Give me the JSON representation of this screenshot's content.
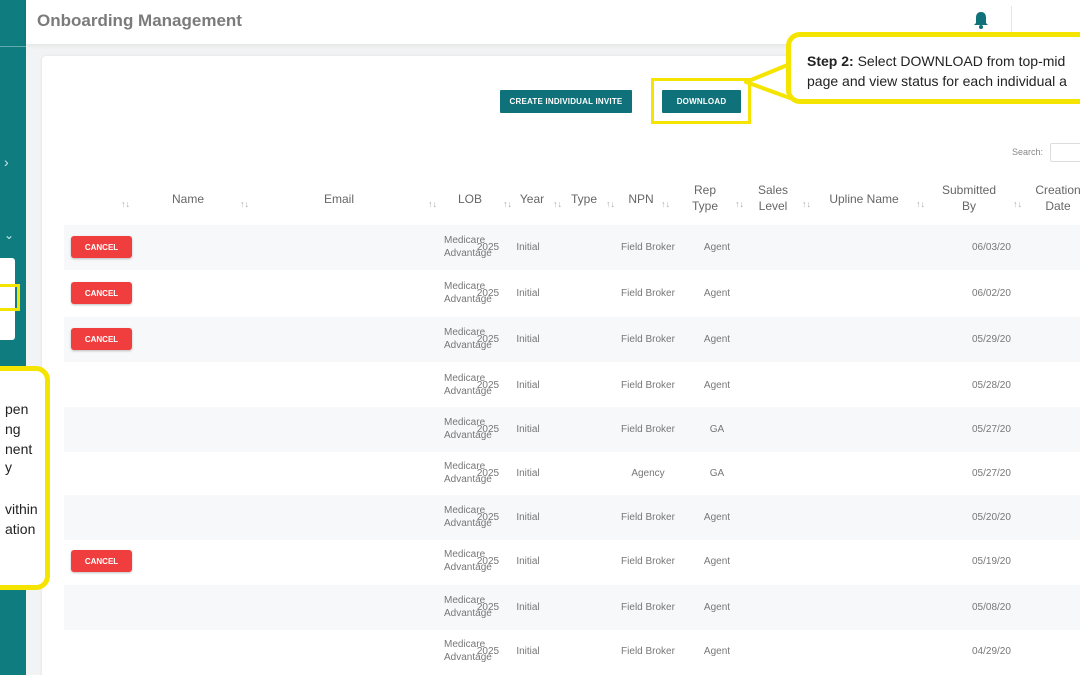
{
  "app": {
    "title": "Onboarding Management"
  },
  "toolbar": {
    "create_label": "CREATE INDIVIDUAL INVITE",
    "download_label": "DOWNLOAD"
  },
  "search": {
    "label": "Search:"
  },
  "table": {
    "columns": [
      "Name",
      "Email",
      "LOB",
      "Year",
      "Type",
      "NPN",
      "Rep Type",
      "Sales Level",
      "Upline Name",
      "Submitted By",
      "Creation Date"
    ],
    "sort_arrow": "↑↓",
    "cancel_label": "CANCEL",
    "rows": [
      {
        "cancel": true,
        "lob": "Medicare Advantage",
        "year": "2025",
        "type": "Initial",
        "rep_type": "Field Broker",
        "sales_level": "Agent",
        "creation_date": "06/03/20"
      },
      {
        "cancel": true,
        "lob": "Medicare Advantage",
        "year": "2025",
        "type": "Initial",
        "rep_type": "Field Broker",
        "sales_level": "Agent",
        "creation_date": "06/02/20"
      },
      {
        "cancel": true,
        "lob": "Medicare Advantage",
        "year": "2025",
        "type": "Initial",
        "rep_type": "Field Broker",
        "sales_level": "Agent",
        "creation_date": "05/29/20"
      },
      {
        "cancel": false,
        "lob": "Medicare Advantage",
        "year": "2025",
        "type": "Initial",
        "rep_type": "Field Broker",
        "sales_level": "Agent",
        "creation_date": "05/28/20"
      },
      {
        "cancel": false,
        "lob": "Medicare Advantage",
        "year": "2025",
        "type": "Initial",
        "rep_type": "Field Broker",
        "sales_level": "GA",
        "creation_date": "05/27/20"
      },
      {
        "cancel": false,
        "lob": "Medicare Advantage",
        "year": "2025",
        "type": "Initial",
        "rep_type": "Agency",
        "sales_level": "GA",
        "creation_date": "05/27/20"
      },
      {
        "cancel": false,
        "lob": "Medicare Advantage",
        "year": "2025",
        "type": "Initial",
        "rep_type": "Field Broker",
        "sales_level": "Agent",
        "creation_date": "05/20/20"
      },
      {
        "cancel": true,
        "lob": "Medicare Advantage",
        "year": "2025",
        "type": "Initial",
        "rep_type": "Field Broker",
        "sales_level": "Agent",
        "creation_date": "05/19/20"
      },
      {
        "cancel": false,
        "lob": "Medicare Advantage",
        "year": "2025",
        "type": "Initial",
        "rep_type": "Field Broker",
        "sales_level": "Agent",
        "creation_date": "05/08/20"
      },
      {
        "cancel": false,
        "lob": "Medicare Advantage",
        "year": "2025",
        "type": "Initial",
        "rep_type": "Field Broker",
        "sales_level": "Agent",
        "creation_date": "04/29/20"
      }
    ]
  },
  "callouts": {
    "step2": {
      "bold": "Step 2:",
      "line1": " Select DOWNLOAD from top-mid",
      "line2": "page and view status for each individual a"
    },
    "left_lines": [
      "pen",
      "ng",
      "nent",
      "y",
      "",
      "vithin",
      "ation"
    ]
  },
  "sidebar": {
    "chevron_right": "›",
    "chevron_down": "⌄"
  },
  "colors": {
    "teal": "#0f7c7f",
    "highlight": "#f5e400",
    "cancel": "#f03e3e"
  }
}
